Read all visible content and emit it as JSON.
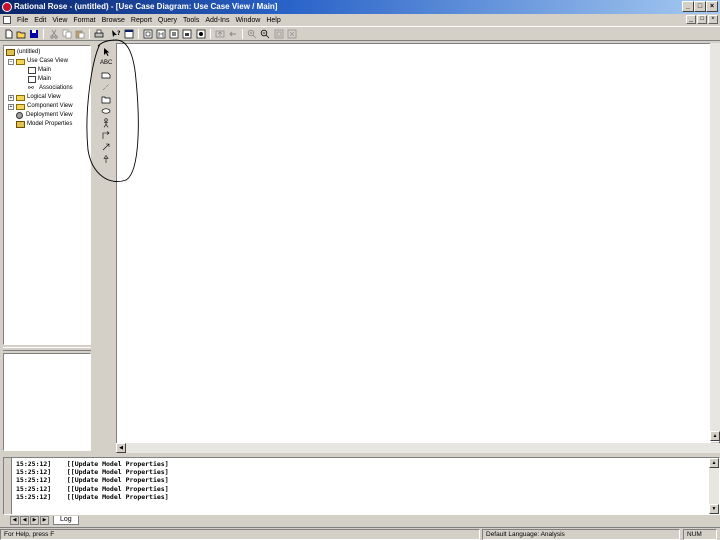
{
  "window": {
    "title": "Rational Rose - (untitled) - [Use Case Diagram: Use Case View / Main]",
    "minimize_glyph": "_",
    "maximize_glyph": "□",
    "close_glyph": "×"
  },
  "menu": {
    "items": [
      "File",
      "Edit",
      "View",
      "Format",
      "Browse",
      "Report",
      "Query",
      "Tools",
      "Add-Ins",
      "Window",
      "Help"
    ]
  },
  "toolbar": {
    "icons": [
      "new-icon",
      "open-icon",
      "save-icon",
      "cut-icon",
      "copy-icon",
      "paste-icon",
      "print-icon",
      "context-help-icon",
      "view-doc-icon",
      "browse-class-diagram-icon",
      "browse-interaction-diagram-icon",
      "browse-component-diagram-icon",
      "browse-deployment-diagram-icon",
      "browse-parent-icon",
      "browse-previous-icon",
      "zoom-in-icon",
      "zoom-out-icon",
      "fit-in-window-icon",
      "undo-fit-icon"
    ]
  },
  "browser": {
    "items": [
      {
        "label": "(untitled)",
        "icon": "model-icon"
      },
      {
        "label": "Use Case View",
        "icon": "folder-icon"
      },
      {
        "label": "Main",
        "icon": "diagram-icon"
      },
      {
        "label": "Main",
        "icon": "diagram-icon"
      },
      {
        "label": "Associations",
        "icon": "associations-icon"
      },
      {
        "label": "Logical View",
        "icon": "folder-icon"
      },
      {
        "label": "Component View",
        "icon": "folder-icon"
      },
      {
        "label": "Deployment View",
        "icon": "deployment-icon"
      },
      {
        "label": "Model Properties",
        "icon": "model-properties-icon"
      }
    ],
    "expand_glyph": "+",
    "collapse_glyph": "−"
  },
  "toolbox": {
    "tools": [
      "selection-tool-icon",
      "text-box-tool-icon",
      "note-tool-icon",
      "anchor-note-tool-icon",
      "package-tool-icon",
      "use-case-tool-icon",
      "actor-tool-icon",
      "unidirectional-association-tool-icon",
      "dependency-tool-icon",
      "generalization-tool-icon"
    ],
    "text_box_label": "ABC"
  },
  "log": {
    "lines": [
      "15:25:12]    [[Update Model Properties]",
      "15:25:12]    [[Update Model Properties]",
      "15:25:12]    [[Update Model Properties]",
      "15:25:12]    [[Update Model Properties]",
      "15:25:12]    [[Update Model Properties]"
    ],
    "tab_label": "Log"
  },
  "statusbar": {
    "help_text": "For Help, press F",
    "language": "Default Language: Analysis",
    "num": "NUM"
  }
}
